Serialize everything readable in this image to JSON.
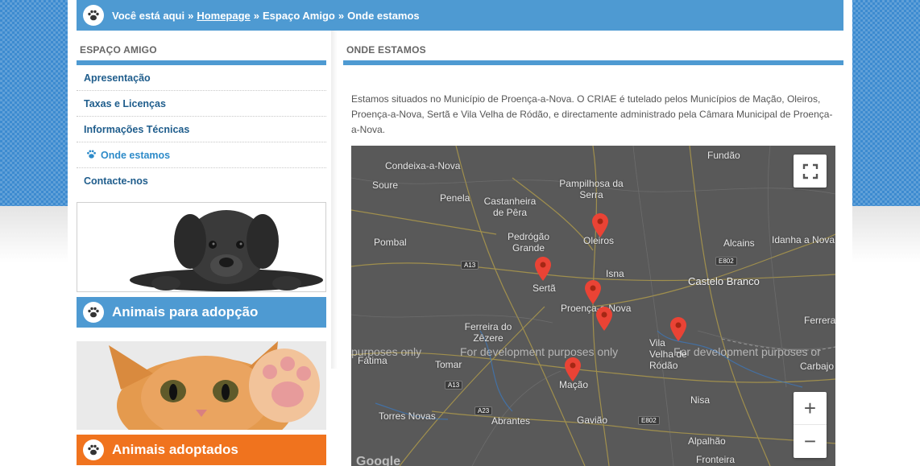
{
  "breadcrumb": {
    "prefix": "Você está aqui",
    "sep1": "»",
    "home": "Homepage",
    "sep2": "»",
    "section": "Espaço Amigo",
    "sep3": "»",
    "current": "Onde estamos"
  },
  "sidebar": {
    "title": "ESPAÇO AMIGO",
    "items": [
      {
        "label": "Apresentação"
      },
      {
        "label": "Taxas e Licenças"
      },
      {
        "label": "Informações Técnicas"
      },
      {
        "label": "Onde estamos",
        "active": true
      },
      {
        "label": "Contacte-nos"
      }
    ],
    "adoption_banner": "Animais para adopção",
    "adopted_banner": "Animais adoptados"
  },
  "main": {
    "title": "ONDE ESTAMOS",
    "text": "Estamos situados no Município de Proença-a-Nova. O CRIAE é tutelado pelos Municípios de Mação, Oleiros, Proença-a-Nova, Sertã e Vila Velha de Ródão, e directamente administrado pela Câmara Municipal de Proença-a-Nova."
  },
  "map": {
    "watermark": "For development purposes only",
    "watermark_left": "purposes only",
    "watermark_right": "For development purposes or",
    "places": {
      "condeixa": "Condeixa-a-Nova",
      "soure": "Soure",
      "penela": "Penela",
      "castanheira": "Castanheira de Pêra",
      "pampilhosa": "Pampilhosa da Serra",
      "fundao": "Fundão",
      "pedrogao": "Pedrógão Grande",
      "oleiros": "Oleiros",
      "pombal": "Pombal",
      "alcains": "Alcains",
      "idanha": "Idanha a Nova",
      "serta": "Sertã",
      "isna": "Isna",
      "castelo_branco": "Castelo Branco",
      "proenca": "Proença-a-Nova",
      "ferreira": "Ferreira do Zêzere",
      "vila_velha": "Vila Velha de Ródão",
      "fatima": "Fátima",
      "tomar": "Tomar",
      "macao": "Mação",
      "carbajo": "Carbajo",
      "ferreira_right": "Ferrera",
      "torres_novas": "Torres Novas",
      "abrantes": "Abrantes",
      "gaviao": "Gavião",
      "nisa": "Nisa",
      "alpalhao": "Alpalhão",
      "fronteira": "Fronteira"
    },
    "roads": {
      "a13_top": "A13",
      "a13_bottom": "A13",
      "a23": "A23",
      "e802_top": "E802",
      "e802_bottom": "E802"
    },
    "zoom_in": "+",
    "zoom_out": "−",
    "logo": "Google"
  }
}
